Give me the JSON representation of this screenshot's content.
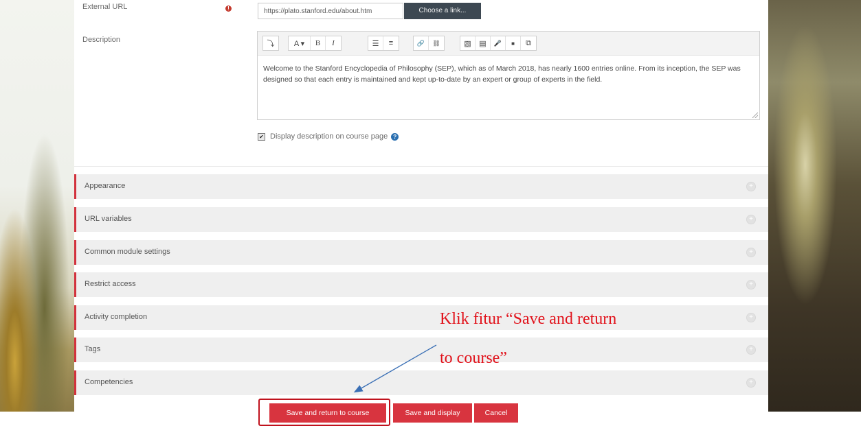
{
  "form": {
    "external_url_label": "External URL",
    "required_glyph": "!",
    "external_url_value": "https://plato.stanford.edu/about.htm",
    "choose_link_label": "Choose a link...",
    "description_label": "Description",
    "toolbar": {
      "group1": [
        "⤵"
      ],
      "group2": [
        "A ▾",
        "B",
        "I"
      ],
      "group3": [
        "☰",
        "≡"
      ],
      "group4": [
        "🔗",
        "⛓"
      ],
      "group5": [
        "▧",
        "▤",
        "🎤",
        "■",
        "⧉"
      ],
      "icon_names": [
        "show-more-icon",
        "font-color-icon",
        "bold-icon",
        "italic-icon",
        "unordered-list-icon",
        "ordered-list-icon",
        "link-icon",
        "unlink-icon",
        "image-icon",
        "media-icon",
        "record-audio-icon",
        "record-video-icon",
        "manage-files-icon"
      ]
    },
    "description_text": "Welcome to the Stanford Encyclopedia of Philosophy (SEP), which as of March 2018, has nearly 1600 entries online. From its inception, the SEP was designed so that each entry is maintained and kept up-to-date by an expert or group of experts in the field.",
    "display_description_label": "Display description on course page",
    "help_glyph": "?"
  },
  "sections": [
    {
      "label": "Appearance"
    },
    {
      "label": "URL variables"
    },
    {
      "label": "Common module settings"
    },
    {
      "label": "Restrict access"
    },
    {
      "label": "Activity completion"
    },
    {
      "label": "Tags"
    },
    {
      "label": "Competencies"
    }
  ],
  "section_expand_glyph": "+",
  "buttons": {
    "save_return": "Save and return to course",
    "save_display": "Save and display",
    "cancel": "Cancel"
  },
  "annotation": {
    "line1": "Klik fitur “Save and return",
    "line2": "to course”"
  },
  "colors": {
    "accent_red": "#d8343f",
    "section_border": "#d2313c",
    "annotation_red": "#e1121b",
    "arrow_blue": "#3a6fb5"
  }
}
